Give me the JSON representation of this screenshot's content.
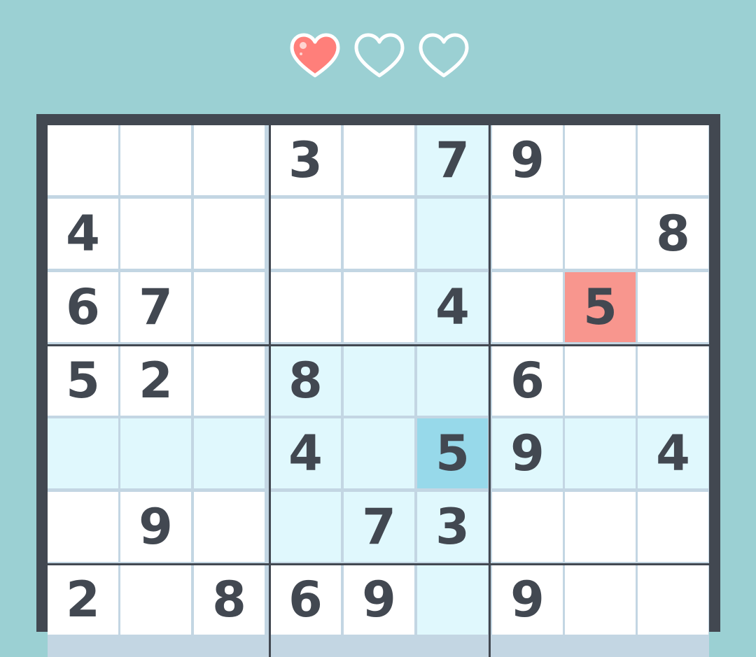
{
  "lives": {
    "total": 3,
    "remaining": 1,
    "icons": [
      "heart-filled-icon",
      "heart-empty-icon",
      "heart-empty-icon"
    ],
    "filled_color": "#ff7f7a",
    "outline_color": "#ffffff"
  },
  "colors": {
    "background": "#9bd0d3",
    "board_frame": "#424851",
    "cell": "#ffffff",
    "highlight": "#e0f8fd",
    "selected": "#97d9ea",
    "error": "#f8968e",
    "digit": "#424851"
  },
  "board": {
    "selected": [
      4,
      5
    ],
    "error_cells": [
      [
        2,
        7
      ]
    ],
    "rows": [
      [
        "",
        "",
        "",
        "3",
        "",
        "7",
        "9",
        "",
        ""
      ],
      [
        "4",
        "",
        "",
        "",
        "",
        "",
        "",
        "",
        "8"
      ],
      [
        "6",
        "7",
        "",
        "",
        "",
        "4",
        "",
        "5",
        ""
      ],
      [
        "5",
        "2",
        "",
        "8",
        "",
        "",
        "6",
        "",
        ""
      ],
      [
        "",
        "",
        "",
        "4",
        "",
        "5",
        "9",
        "",
        "4"
      ],
      [
        "",
        "9",
        "",
        "",
        "7",
        "3",
        "",
        "",
        ""
      ],
      [
        "2",
        "",
        "8",
        "6",
        "9",
        "",
        "9",
        "",
        ""
      ]
    ]
  }
}
